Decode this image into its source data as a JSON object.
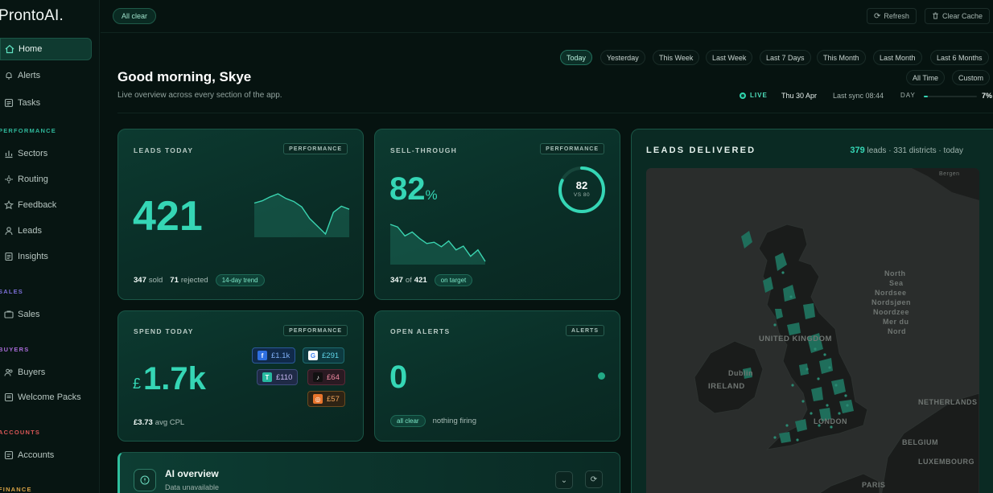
{
  "app": {
    "brand": "ProntoAI."
  },
  "sidebar": {
    "items": [
      {
        "label": "Home",
        "icon": "home-icon"
      },
      {
        "label": "Alerts",
        "icon": "bell-icon"
      },
      {
        "label": "Tasks",
        "icon": "list-icon"
      },
      {
        "label": "Sectors",
        "icon": "sectors-icon"
      },
      {
        "label": "Routing",
        "icon": "routing-icon"
      },
      {
        "label": "Feedback",
        "icon": "star-icon"
      },
      {
        "label": "Leads",
        "icon": "user-icon"
      },
      {
        "label": "Insights",
        "icon": "document-icon"
      },
      {
        "label": "Sales",
        "icon": "sales-icon"
      },
      {
        "label": "Buyers",
        "icon": "buyers-icon"
      },
      {
        "label": "Welcome Packs",
        "icon": "pack-icon"
      },
      {
        "label": "Accounts",
        "icon": "accounts-icon"
      }
    ],
    "sections": {
      "performance": "PERFORMANCE",
      "sales": "SALES",
      "buyers": "BUYERS",
      "accounts": "ACCOUNTS",
      "finance": "FINANCE"
    },
    "section_colors": {
      "performance": "#2fb79a",
      "sales": "#7b6fd6",
      "buyers": "#a96bd8",
      "accounts": "#d95757",
      "finance": "#d9a446"
    }
  },
  "topbar": {
    "status_pill": "All clear",
    "refresh_label": "Refresh",
    "clear_cache_label": "Clear Cache"
  },
  "header": {
    "greeting": "Good morning, Skye",
    "subtitle": "Live overview across every section of the app.",
    "ranges": [
      "Today",
      "Yesterday",
      "This Week",
      "Last Week",
      "Last 7 Days",
      "This Month",
      "Last Month",
      "Last 6 Months",
      "All Time",
      "Custom"
    ],
    "active_range": "Today",
    "live_label": "LIVE",
    "date": "Thu 30 Apr",
    "last_sync": "Last sync 08:44",
    "day_label": "DAY",
    "day_progress_label": "7%",
    "day_progress": 0.07
  },
  "cards": {
    "leads_today": {
      "title": "LEADS TODAY",
      "tag": "PERFORMANCE",
      "value": "421",
      "sold": "347",
      "sold_label": "sold",
      "rejected": "71",
      "rejected_label": "rejected",
      "badge": "14-day trend",
      "sparkline": [
        60,
        63,
        68,
        72,
        66,
        62,
        55,
        40,
        30,
        20,
        48,
        56,
        52
      ]
    },
    "sell_through": {
      "title": "SELL-THROUGH",
      "tag": "PERFORMANCE",
      "value": "82",
      "unit": "%",
      "ring_value": "82",
      "ring_sub": "VS 80",
      "ring_fraction": 0.82,
      "count": "347",
      "of_label": "of",
      "total": "421",
      "badge": "on target",
      "sparkline": [
        70,
        66,
        52,
        58,
        48,
        40,
        42,
        35,
        44,
        30,
        36,
        20,
        30,
        12
      ]
    },
    "spend_today": {
      "title": "SPEND TODAY",
      "tag": "PERFORMANCE",
      "currency": "£",
      "value": "1.7k",
      "avg": "£3.73",
      "avg_label": "avg CPL",
      "sources": [
        {
          "name": "facebook",
          "icon": "facebook-icon",
          "glyph": "f",
          "value": "£1.1k",
          "color": "#4d8ff2",
          "bg": "#102a4a",
          "border": "#2b5a9a"
        },
        {
          "name": "google",
          "icon": "google-icon",
          "glyph": "G",
          "value": "£291",
          "color": "#5fd3e6",
          "bg": "#0d3a40",
          "border": "#1f6b70"
        },
        {
          "name": "tutor",
          "icon": "tutor-icon",
          "glyph": "T",
          "value": "£110",
          "color": "#c9b8f2",
          "bg": "#1f2a46",
          "border": "#3b4b7a"
        },
        {
          "name": "tiktok",
          "icon": "tiktok-icon",
          "glyph": "♪",
          "value": "£64",
          "color": "#f08aa0",
          "bg": "#2a1a22",
          "border": "#5a2a38"
        },
        {
          "name": "other",
          "icon": "target-icon",
          "glyph": "◎",
          "value": "£57",
          "color": "#f0a45a",
          "bg": "#2e2314",
          "border": "#6a4a1f"
        }
      ]
    },
    "open_alerts": {
      "title": "OPEN ALERTS",
      "tag": "ALERTS",
      "value": "0",
      "badge": "all clear",
      "note": "nothing firing"
    },
    "leads_delivered": {
      "title": "LEADS DELIVERED",
      "count": "379",
      "count_label": "leads",
      "districts": "· 331 districts · today",
      "map_labels": [
        "Bergen",
        "North",
        "Sea",
        "Nordsee",
        "Nordsjøen",
        "Noordzee",
        "Mer du",
        "Nord",
        "UNITED KINGDOM",
        "Dublin",
        "IRELAND",
        "LONDON",
        "NETHERLANDS",
        "BELGIUM",
        "LUXEMBOURG",
        "PARIS"
      ]
    }
  },
  "ai": {
    "title": "AI overview",
    "status": "Data unavailable"
  },
  "colors": {
    "accent": "#35d6b5",
    "background": "#061310",
    "card": "#0b342c"
  }
}
